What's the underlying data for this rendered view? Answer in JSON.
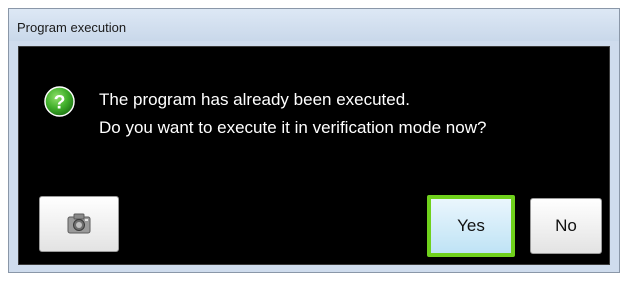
{
  "window": {
    "title": "Program execution"
  },
  "dialog": {
    "message_line1": "The program has already been executed.",
    "message_line2": "Do you want to execute it in verification mode now?",
    "icon": "question-icon"
  },
  "buttons": {
    "camera_icon": "camera-icon",
    "yes_label": "Yes",
    "no_label": "No"
  },
  "colors": {
    "background": "#000000",
    "text": "#ffffff",
    "question_icon": "#3fae2a",
    "highlight": "#6fd11c"
  }
}
